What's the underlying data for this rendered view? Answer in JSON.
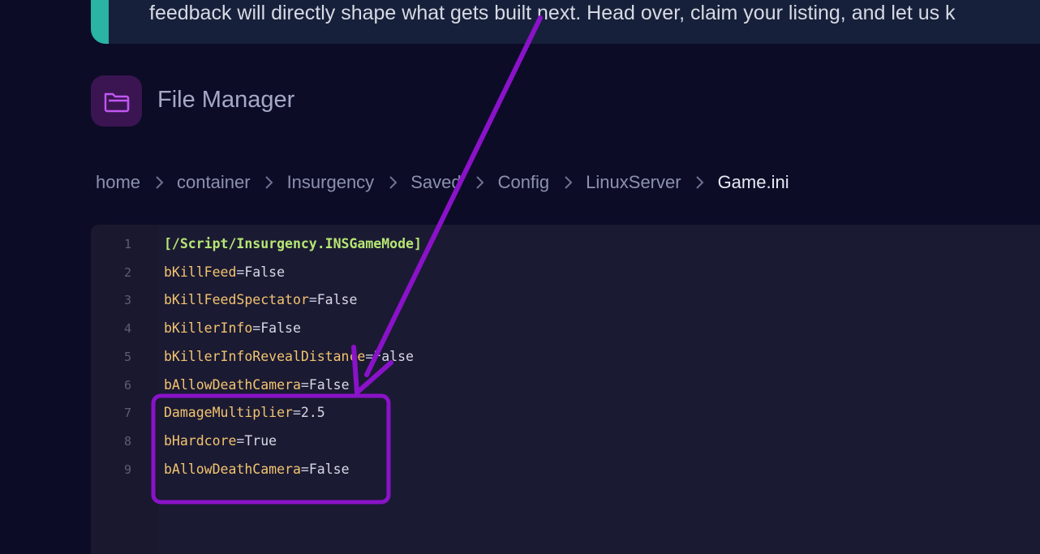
{
  "banner": {
    "text": "feedback will directly shape what gets built next. Head over, claim your listing, and let us k"
  },
  "header": {
    "title": "File Manager",
    "icon": "folder-icon"
  },
  "breadcrumb": {
    "items": [
      "home",
      "container",
      "Insurgency",
      "Saved",
      "Config",
      "LinuxServer"
    ],
    "current": "Game.ini"
  },
  "editor": {
    "lines": [
      {
        "num": "1",
        "section": "[/Script/Insurgency.INSGameMode]"
      },
      {
        "num": "2",
        "key": "bKillFeed",
        "eq": "=",
        "value": "False"
      },
      {
        "num": "3",
        "key": "bKillFeedSpectator",
        "eq": "=",
        "value": "False"
      },
      {
        "num": "4",
        "key": "bKillerInfo",
        "eq": "=",
        "value": "False"
      },
      {
        "num": "5",
        "key": "bKillerInfoRevealDistance",
        "eq": "=",
        "value": "False"
      },
      {
        "num": "6",
        "key": "bAllowDeathCamera",
        "eq": "=",
        "value": "False"
      },
      {
        "num": "7",
        "key": "DamageMultiplier",
        "eq": "=",
        "value": "2.5"
      },
      {
        "num": "8",
        "key": "bHardcore",
        "eq": "=",
        "value": "True"
      },
      {
        "num": "9",
        "key": "bAllowDeathCamera",
        "eq": "=",
        "value": "False"
      }
    ]
  },
  "colors": {
    "background": "#0c0c27",
    "banner_accent": "#2bb3a3",
    "annotation": "#8a12c9",
    "key": "#f2c46f",
    "section": "#b6e673"
  }
}
